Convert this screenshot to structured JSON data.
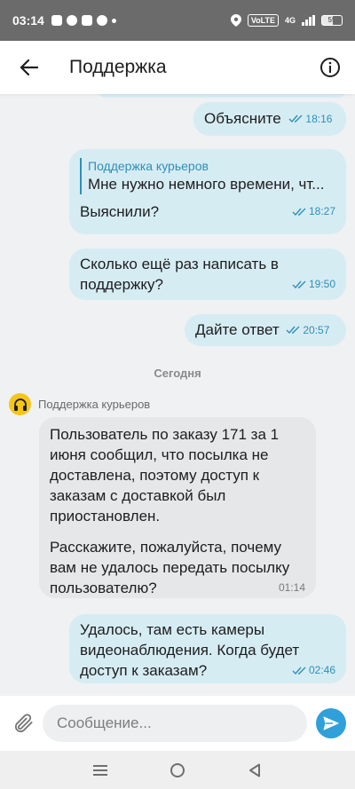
{
  "status_bar": {
    "time": "03:14",
    "volte": "VoLTE",
    "network": "4G",
    "battery": "59"
  },
  "header": {
    "title": "Поддержка"
  },
  "messages": [
    {
      "text": "Объясните",
      "time": "18:16"
    },
    {
      "quote_author": "Поддержка курьеров",
      "quote_text": "Мне нужно немного времени, чт...",
      "text": "Выяснили?",
      "time": "18:27"
    },
    {
      "text_line1": "Сколько ещё раз написать в",
      "text_line2": "поддержку?",
      "time": "19:50"
    },
    {
      "text": "Дайте ответ",
      "time": "20:57"
    }
  ],
  "date_separator": "Сегодня",
  "incoming": {
    "sender": "Поддержка курьеров",
    "lines": [
      "Пользователь по заказу 171 за 1",
      "июня сообщил, что посылка не",
      "доставлена, поэтому доступ к",
      "заказам с доставкой был",
      "приостановлен.",
      "Расскажите, пожалуйста, почему",
      "вам не удалось передать посылку",
      "пользователю?"
    ],
    "time": "01:14"
  },
  "last_message": {
    "lines": [
      "Удалось, там есть камеры",
      "видеонаблюдения. Когда будет",
      "доступ к заказам?"
    ],
    "time": "02:46"
  },
  "composer": {
    "placeholder": "Сообщение..."
  }
}
